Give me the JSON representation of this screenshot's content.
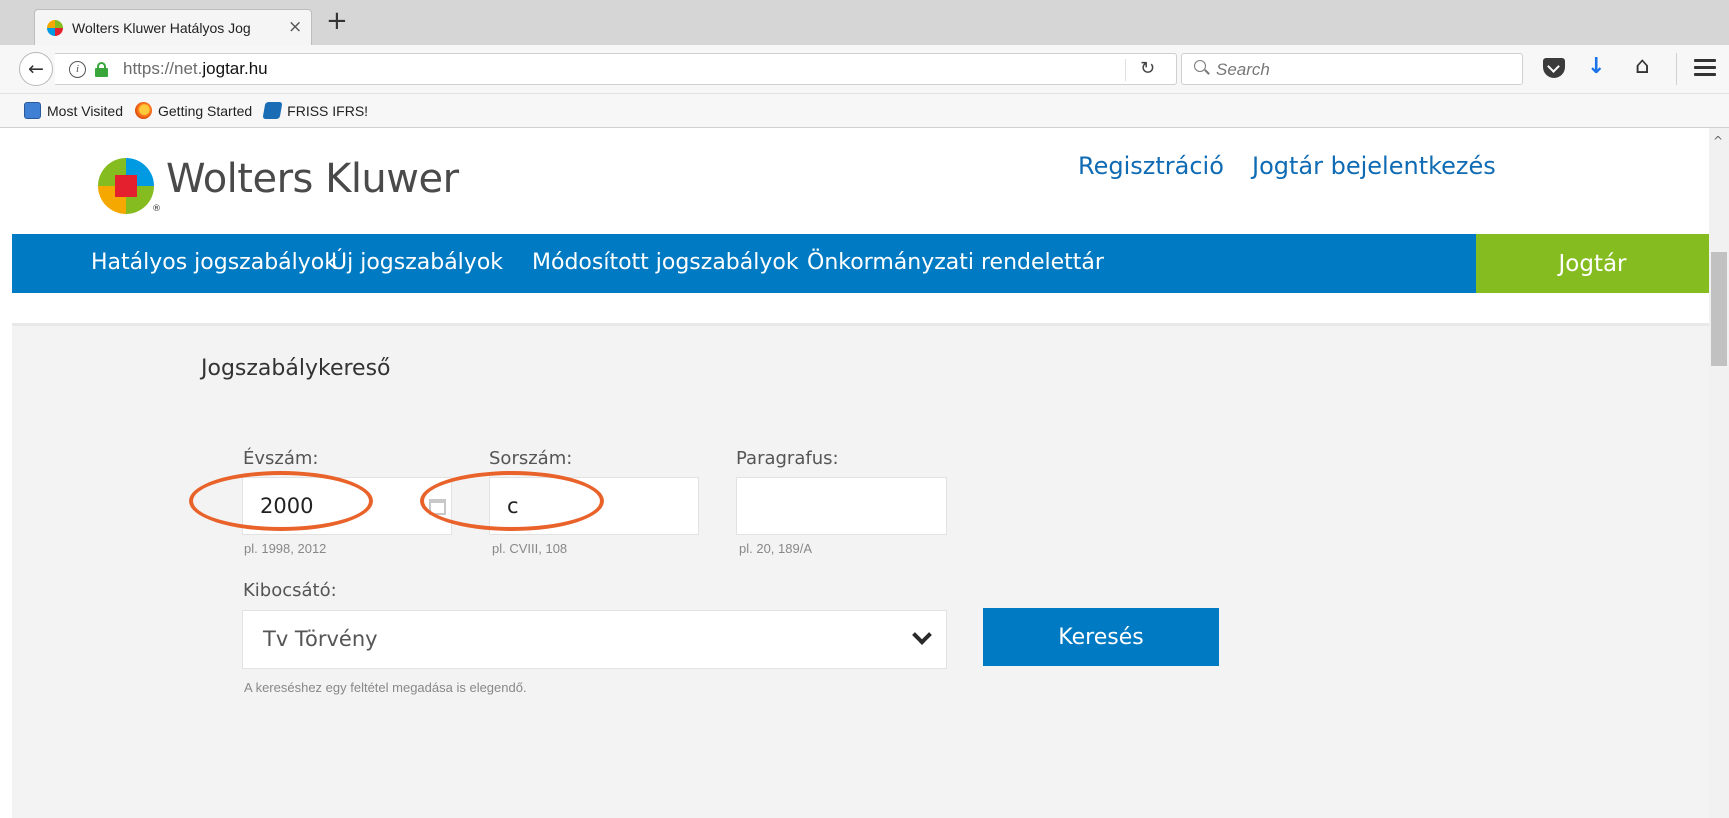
{
  "browser": {
    "tab_title": "Wolters Kluwer Hatályos Jog",
    "tab_close": "×",
    "new_tab": "+",
    "back_glyph": "←",
    "info_glyph": "i",
    "url_prefix": "https://net.",
    "url_domain": "jogtar.hu",
    "reload_glyph": "↻",
    "search_placeholder": "Search",
    "download_glyph": "↓",
    "home_glyph": "⌂",
    "bookmarks": [
      {
        "label": "Most Visited",
        "icon": "most-visited-icon"
      },
      {
        "label": "Getting Started",
        "icon": "firefox-icon"
      },
      {
        "label": "FRISS IFRS!",
        "icon": "kh-icon"
      }
    ]
  },
  "header": {
    "logo_text": "Wolters Kluwer",
    "logo_reg": "®",
    "register_link": "Regisztráció",
    "login_link": "Jogtár bejelentkezés"
  },
  "nav": {
    "items": [
      "Hatályos jogszabályok",
      "Új jogszabályok",
      "Módosított jogszabályok",
      "Önkormányzati rendelettár"
    ],
    "jogtar_button": "Jogtár"
  },
  "search_form": {
    "title": "Jogszabálykereső",
    "year": {
      "label": "Évszám:",
      "value": "2000",
      "hint": "pl. 1998, 2012"
    },
    "number": {
      "label": "Sorszám:",
      "value": "c",
      "hint": "pl. CVIII, 108"
    },
    "paragraph": {
      "label": "Paragrafus:",
      "value": "",
      "hint": "pl. 20, 189/A"
    },
    "issuer": {
      "label": "Kibocsátó:",
      "value": "Tv Törvény"
    },
    "submit_label": "Keresés",
    "note": "A kereséshez egy feltétel megadása is elegendő."
  },
  "scroll_up_glyph": "^",
  "colors": {
    "nav_blue": "#007ac2",
    "jogtar_green": "#85bc20",
    "link_blue": "#0f6bb4",
    "annotation_orange": "#e8622a"
  }
}
